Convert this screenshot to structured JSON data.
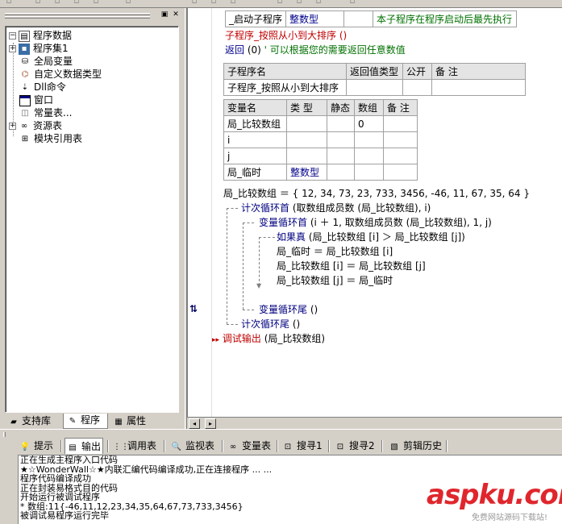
{
  "tree": {
    "root": "程序数据",
    "items": [
      "程序集1",
      "全局变量",
      "自定义数据类型",
      "Dll命令",
      "窗口",
      "常量表...",
      "资源表",
      "模块引用表"
    ]
  },
  "left_tabs": [
    "支持库",
    "程序",
    "属性"
  ],
  "editor": {
    "startup_row": [
      "_启动子程序",
      "整数型",
      "",
      "本子程序在程序启动后最先执行"
    ],
    "sub_decl": "子程序_按照从小到大排序  ()",
    "return_kw": "返回",
    "return_args": "(0)",
    "return_comment": "' 可以根据您的需要返回任意数值",
    "sub_table": {
      "headers": [
        "子程序名",
        "返回值类型",
        "公开",
        "备 注"
      ],
      "rows": [
        [
          "子程序_按照从小到大排序",
          "",
          "",
          ""
        ]
      ]
    },
    "var_table": {
      "headers": [
        "变量名",
        "类 型",
        "静态",
        "数组",
        "备 注"
      ],
      "rows": [
        [
          "局_比较数组",
          "",
          "",
          "0",
          ""
        ],
        [
          "i",
          "",
          "",
          "",
          ""
        ],
        [
          "j",
          "",
          "",
          "",
          ""
        ],
        [
          "局_临时",
          "整数型",
          "",
          "",
          ""
        ]
      ]
    },
    "lines": {
      "assign": "局_比较数组 ＝ { 12, 34, 73, 23, 733, 3456, -46, 11, 67, 35, 64 }",
      "loop1_kw": "计次循环首",
      "loop1_args": "(取数组成员数 (局_比较数组), i)",
      "loop2_kw": "变量循环首",
      "loop2_args": "(i ＋ 1, 取数组成员数 (局_比较数组), 1, j)",
      "if_kw": "如果真",
      "if_args": "(局_比较数组 [i] ＞ 局_比较数组 [j])",
      "swap1": "局_临时 ＝ 局_比较数组 [i]",
      "swap2": "局_比较数组 [i] ＝ 局_比较数组 [j]",
      "swap3": "局_比较数组 [j] ＝ 局_临时",
      "loop2_end_kw": "变量循环尾",
      "loop2_end_args": "()",
      "loop1_end_kw": "计次循环尾",
      "loop1_end_args": "()",
      "debug_kw": "调试输出",
      "debug_args": "(局_比较数组)"
    }
  },
  "bottom_tabs": [
    "提示",
    "输出",
    "调用表",
    "监视表",
    "变量表",
    "搜寻1",
    "搜寻2",
    "剪辑历史"
  ],
  "output": [
    "正在生成主程序入口代码",
    "★☆WonderWall☆★内联汇编代码编译成功,正在连接程序 ... ...",
    "程序代码编译成功",
    "正在封装易格式目的代码",
    "开始运行被调试程序",
    "* 数组:11{-46,11,12,23,34,35,64,67,73,733,3456}",
    "被调试易程序运行完毕"
  ],
  "watermark": {
    "main": "aspku.com",
    "sub": "免费网站源码下载站!"
  }
}
